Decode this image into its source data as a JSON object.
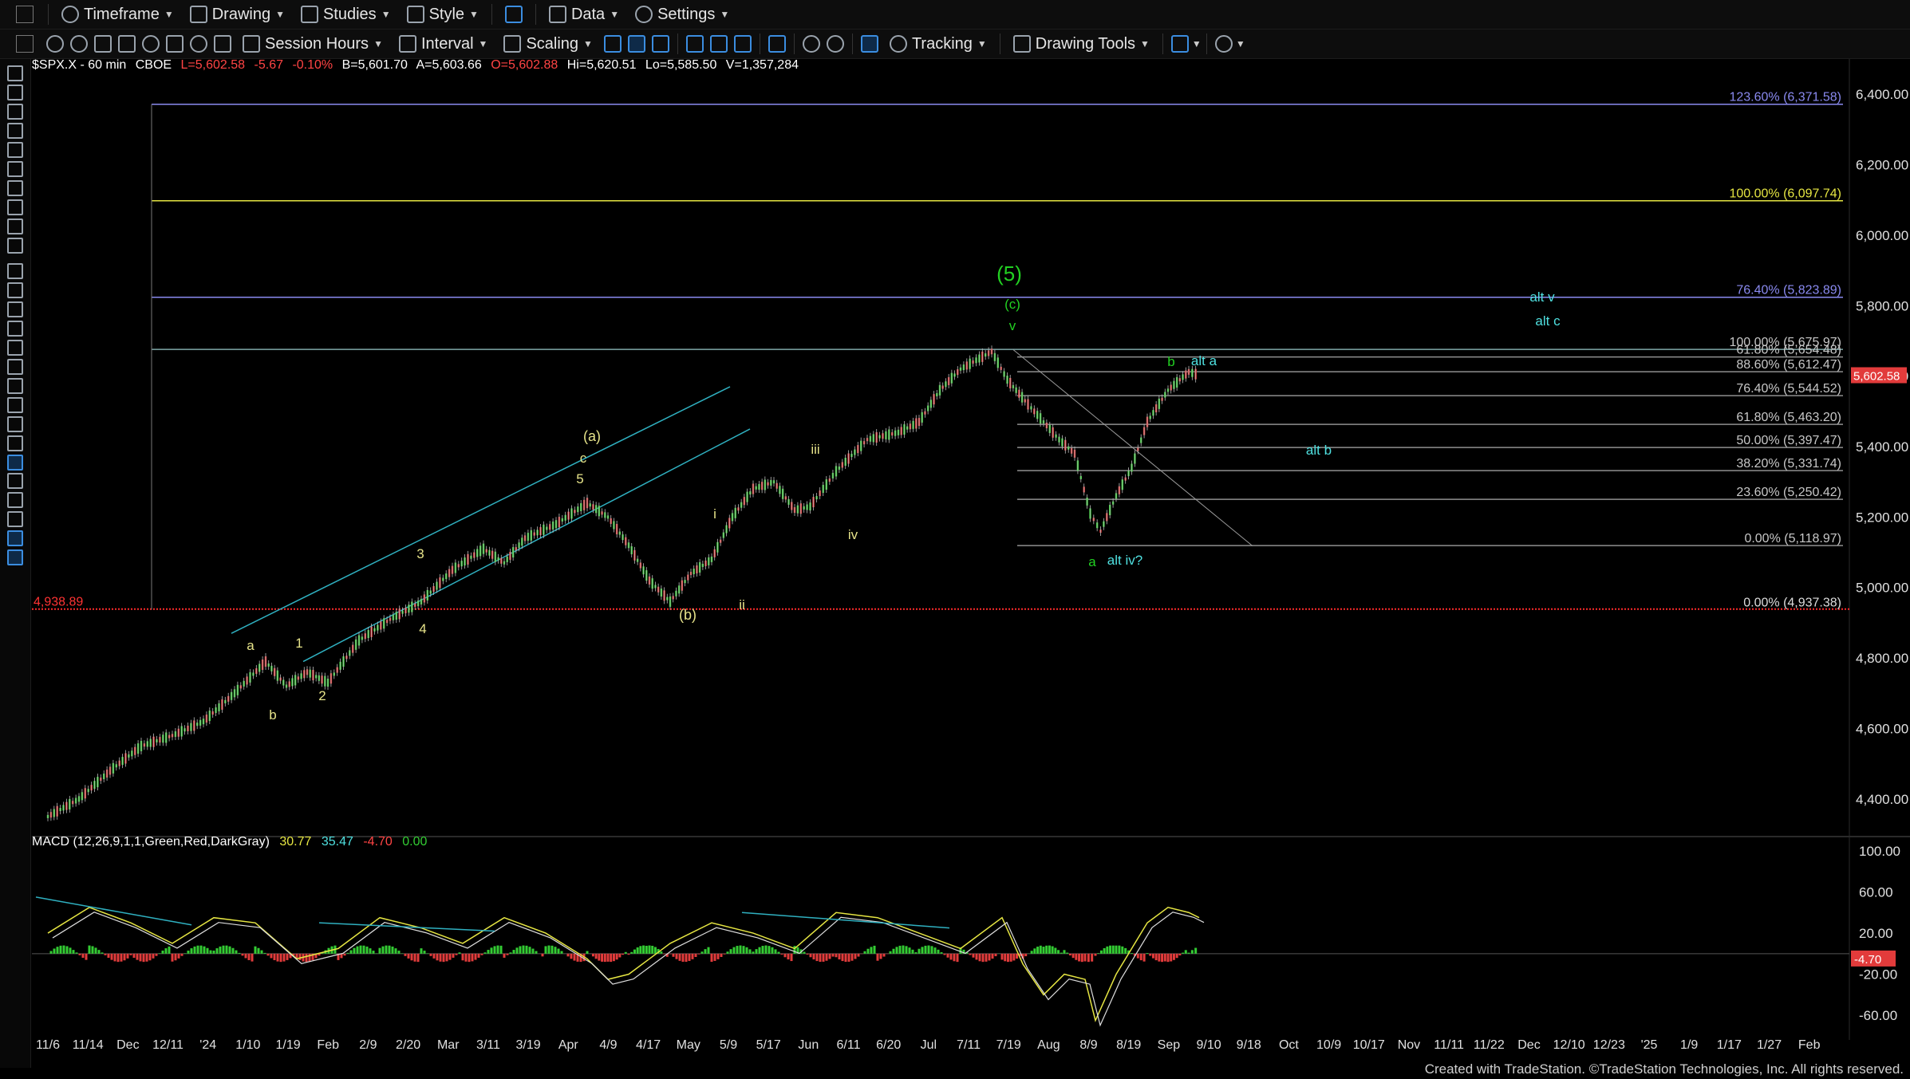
{
  "toolbar1": [
    {
      "label": "Timeframe",
      "icon": "clock-icon"
    },
    {
      "label": "Drawing",
      "icon": "pencil-icon"
    },
    {
      "label": "Studies",
      "icon": "flask-icon"
    },
    {
      "label": "Style",
      "icon": "style-icon"
    },
    {
      "label": "",
      "icon": "layout-icon"
    },
    {
      "label": "Data",
      "icon": "bars-icon"
    },
    {
      "label": "Settings",
      "icon": "gear-icon"
    }
  ],
  "toolbar2": {
    "session_label": "Session Hours",
    "interval_label": "Interval",
    "scaling_label": "Scaling",
    "tracking_label": "Tracking",
    "drawing_tools_label": "Drawing Tools"
  },
  "header": {
    "symbol": "$SPX.X - 60 min",
    "exchange": "CBOE",
    "last": "L=5,602.58",
    "change": "-5.67",
    "pct": "-0.10%",
    "bid": "B=5,601.70",
    "ask": "A=5,603.66",
    "open": "O=5,602.88",
    "high": "Hi=5,620.51",
    "low": "Lo=5,585.50",
    "volume": "V=1,357,284"
  },
  "macd_header": {
    "label": "MACD (12,26,9,1,1,Green,Red,DarkGray)",
    "v1": "30.77",
    "v2": "35.47",
    "v3": "-4.70",
    "v4": "0.00"
  },
  "footer": "Created with TradeStation. ©TradeStation Technologies, Inc. All rights reserved.",
  "colors": {
    "up": "#33cc33",
    "down": "#e23b3b",
    "green_label": "#22d022",
    "yellow_label": "#e7e48a",
    "cyan_label": "#4fe0e0",
    "fib_text": "#c8c8c8",
    "hline_red": "#ff2a2a",
    "blue_fib": "#8a8af0",
    "yellow_fib": "#e5e542"
  },
  "chart_data": [
    {
      "type": "line",
      "title": "$SPX.X - 60 min",
      "ylim": [
        4300,
        6500
      ],
      "y_ticks": [
        "6,400.00",
        "6,200.00",
        "6,000.00",
        "5,800.00",
        "5,600.00",
        "5,400.00",
        "5,200.00",
        "5,000.00",
        "4,800.00",
        "4,600.00",
        "4,400.00"
      ],
      "x_ticks": [
        "11/6",
        "11/14",
        "Dec",
        "12/11",
        "'24",
        "1/10",
        "1/19",
        "Feb",
        "2/9",
        "2/20",
        "Mar",
        "3/11",
        "3/19",
        "Apr",
        "4/9",
        "4/17",
        "May",
        "5/9",
        "5/17",
        "Jun",
        "6/11",
        "6/20",
        "Jul",
        "7/11",
        "7/19",
        "Aug",
        "8/9",
        "8/19",
        "Sep",
        "9/10",
        "9/18",
        "Oct",
        "10/9",
        "10/17",
        "Nov",
        "11/11",
        "11/22",
        "Dec",
        "12/10",
        "12/23",
        "'25",
        "1/9",
        "1/17",
        "1/27",
        "Feb"
      ],
      "last_price_label": "5,602.58",
      "hline": {
        "value": 4938.89,
        "label": "4,938.89"
      },
      "series": [
        {
          "values": [
            [
              0,
              4350
            ],
            [
              30,
              4400
            ],
            [
              60,
              4480
            ],
            [
              90,
              4550
            ],
            [
              120,
              4580
            ],
            [
              150,
              4620
            ],
            [
              180,
              4700
            ],
            [
              210,
              4790
            ],
            [
              230,
              4720
            ],
            [
              250,
              4760
            ],
            [
              270,
              4730
            ],
            [
              300,
              4850
            ],
            [
              330,
              4910
            ],
            [
              360,
              4960
            ],
            [
              390,
              5050
            ],
            [
              420,
              5110
            ],
            [
              440,
              5070
            ],
            [
              460,
              5140
            ],
            [
              490,
              5180
            ],
            [
              520,
              5240
            ],
            [
              540,
              5200
            ],
            [
              560,
              5120
            ],
            [
              580,
              5020
            ],
            [
              600,
              4960
            ],
            [
              620,
              5040
            ],
            [
              640,
              5080
            ],
            [
              660,
              5200
            ],
            [
              680,
              5280
            ],
            [
              700,
              5300
            ],
            [
              720,
              5220
            ],
            [
              735,
              5230
            ],
            [
              760,
              5330
            ],
            [
              790,
              5420
            ],
            [
              820,
              5440
            ],
            [
              840,
              5470
            ],
            [
              860,
              5560
            ],
            [
              880,
              5620
            ],
            [
              910,
              5670
            ],
            [
              925,
              5590
            ],
            [
              945,
              5520
            ],
            [
              960,
              5470
            ],
            [
              975,
              5420
            ],
            [
              990,
              5380
            ],
            [
              1005,
              5210
            ],
            [
              1015,
              5160
            ],
            [
              1030,
              5260
            ],
            [
              1045,
              5340
            ],
            [
              1060,
              5470
            ],
            [
              1080,
              5560
            ],
            [
              1100,
              5612
            ],
            [
              1110,
              5602.58
            ]
          ]
        }
      ],
      "fib_levels": [
        {
          "pct": "123.60% (6,371.58)",
          "value": 6371.58
        },
        {
          "pct": "100.00% (6,097.74)",
          "value": 6097.74
        },
        {
          "pct": "76.40% (5,823.89)",
          "value": 5823.89
        },
        {
          "pct": "100.00% (5,675.97)",
          "value": 5675.97
        },
        {
          "pct": "61.80% (5,654.48)",
          "value": 5654.48
        },
        {
          "pct": "88.60% (5,612.47)",
          "value": 5612.47
        },
        {
          "pct": "76.40% (5,544.52)",
          "value": 5544.52
        },
        {
          "pct": "61.80% (5,463.20)",
          "value": 5463.2
        },
        {
          "pct": "50.00% (5,397.47)",
          "value": 5397.47
        },
        {
          "pct": "38.20% (5,331.74)",
          "value": 5331.74
        },
        {
          "pct": "23.60% (5,250.42)",
          "value": 5250.42
        },
        {
          "pct": "0.00% (5,118.97)",
          "value": 5118.97
        },
        {
          "pct": "0.00% (4,937.38)",
          "value": 4937.38
        }
      ],
      "annotations": [
        {
          "text": "(5)",
          "color": "green"
        },
        {
          "text": "(c)",
          "color": "green"
        },
        {
          "text": "v",
          "color": "green"
        },
        {
          "text": "b",
          "color": "green"
        },
        {
          "text": "alt a",
          "color": "cyan"
        },
        {
          "text": "alt v",
          "color": "cyan"
        },
        {
          "text": "alt c",
          "color": "cyan"
        },
        {
          "text": "alt b",
          "color": "cyan"
        },
        {
          "text": "a",
          "color": "green"
        },
        {
          "text": "alt iv?",
          "color": "cyan"
        },
        {
          "text": "(a)",
          "color": "yellow"
        },
        {
          "text": "c",
          "color": "yellow"
        },
        {
          "text": "5",
          "color": "yellow"
        },
        {
          "text": "3",
          "color": "yellow"
        },
        {
          "text": "4",
          "color": "yellow"
        },
        {
          "text": "1",
          "color": "yellow"
        },
        {
          "text": "2",
          "color": "yellow"
        },
        {
          "text": "a",
          "color": "yellow"
        },
        {
          "text": "b",
          "color": "yellow"
        },
        {
          "text": "(b)",
          "color": "yellow"
        },
        {
          "text": "i",
          "color": "yellow"
        },
        {
          "text": "ii",
          "color": "yellow"
        },
        {
          "text": "iii",
          "color": "yellow"
        },
        {
          "text": "iv",
          "color": "yellow"
        }
      ]
    },
    {
      "type": "line",
      "title": "MACD (12,26,9,1,1,Green,Red,DarkGray)",
      "ylim": [
        -80,
        110
      ],
      "y_ticks": [
        "100.00",
        "60.00",
        "20.00",
        "-20.00",
        "-60.00"
      ],
      "last_value_label": "-4.70",
      "series": [
        {
          "values": [
            [
              0,
              20
            ],
            [
              40,
              45
            ],
            [
              80,
              30
            ],
            [
              120,
              10
            ],
            [
              160,
              35
            ],
            [
              200,
              30
            ],
            [
              240,
              -5
            ],
            [
              280,
              5
            ],
            [
              320,
              35
            ],
            [
              360,
              25
            ],
            [
              400,
              10
            ],
            [
              440,
              35
            ],
            [
              480,
              20
            ],
            [
              520,
              -5
            ],
            [
              540,
              -25
            ],
            [
              560,
              -20
            ],
            [
              580,
              -5
            ],
            [
              600,
              10
            ],
            [
              640,
              30
            ],
            [
              680,
              20
            ],
            [
              720,
              5
            ],
            [
              760,
              40
            ],
            [
              800,
              35
            ],
            [
              840,
              20
            ],
            [
              880,
              5
            ],
            [
              920,
              35
            ],
            [
              940,
              -10
            ],
            [
              960,
              -40
            ],
            [
              980,
              -20
            ],
            [
              1000,
              -25
            ],
            [
              1010,
              -65
            ],
            [
              1030,
              -20
            ],
            [
              1060,
              30
            ],
            [
              1080,
              45
            ],
            [
              1100,
              40
            ],
            [
              1110,
              35
            ]
          ]
        }
      ]
    }
  ]
}
